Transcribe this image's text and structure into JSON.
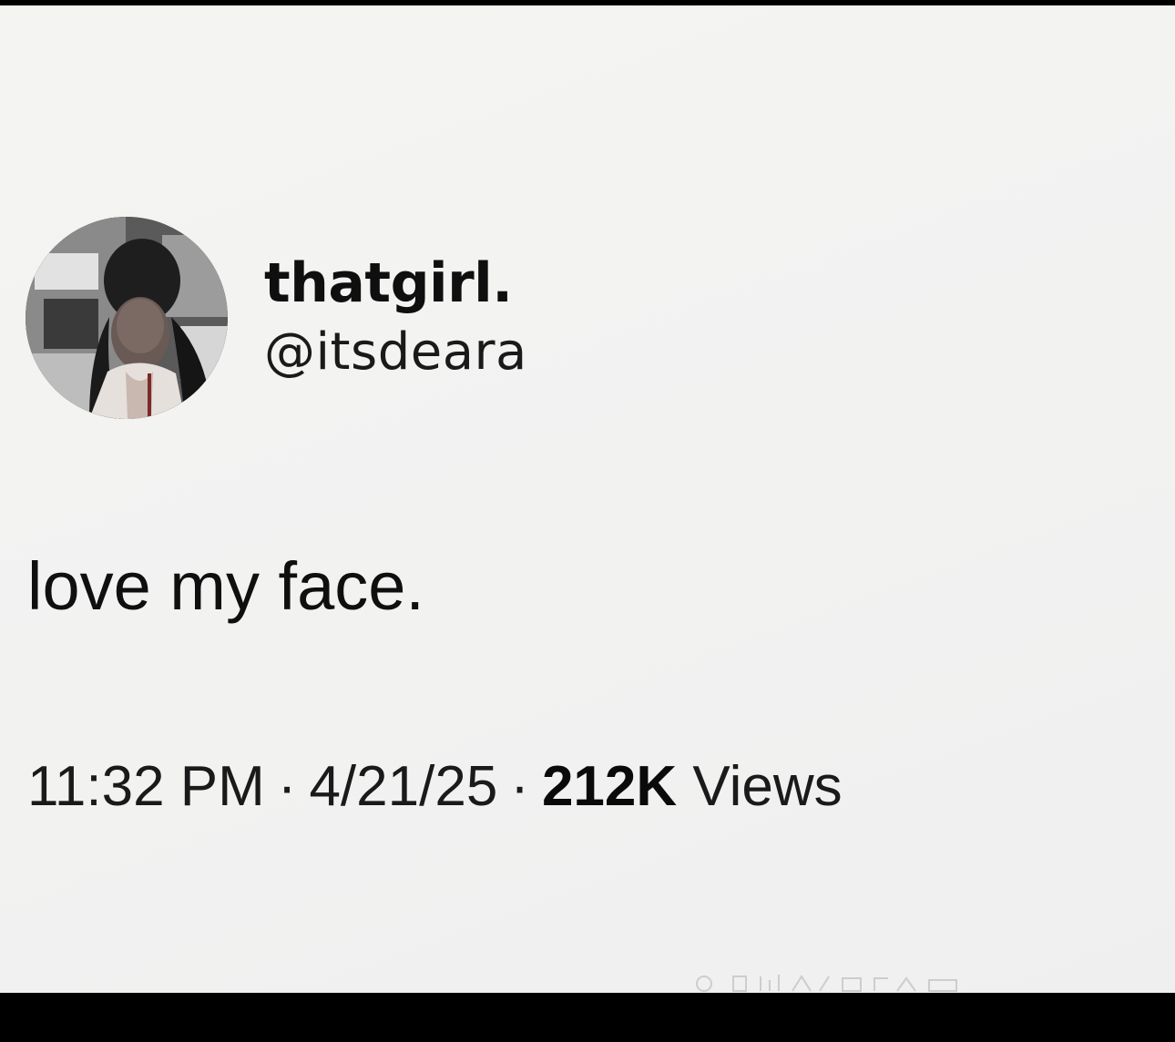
{
  "tweet": {
    "display_name": "thatgirl.",
    "handle": "@itsdeara",
    "text": "love my face.",
    "time": "11:32 PM",
    "separator": "·",
    "date": "4/21/25",
    "views_count": "212K",
    "views_label": "Views"
  },
  "avatar": {
    "icon": "profile-photo",
    "colors": [
      "#2b2b2b",
      "#6e6e6e",
      "#b8b8b8",
      "#e9e9e9"
    ]
  },
  "colors": {
    "background": "#f3f3f2",
    "text": "#0f0f0f",
    "border": "#000000"
  }
}
